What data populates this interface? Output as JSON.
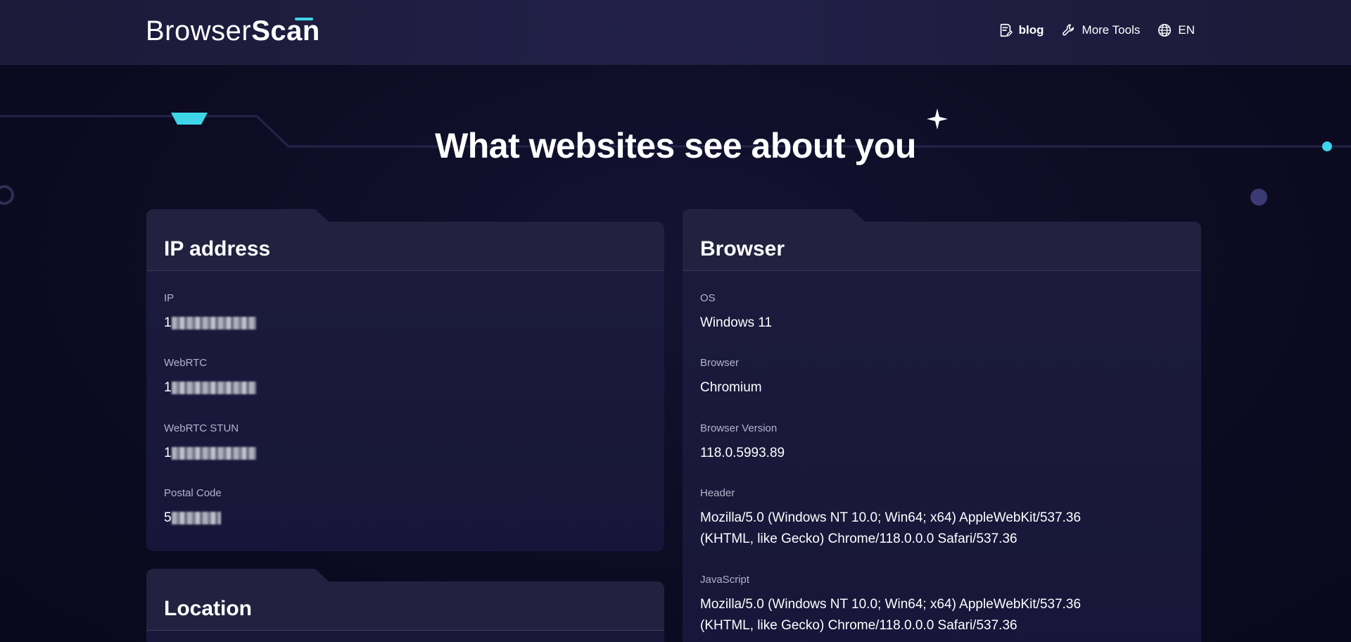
{
  "header": {
    "logo_part1": "Browser",
    "logo_part2": "Scan",
    "nav": [
      {
        "label": "blog",
        "icon": "document-edit-icon"
      },
      {
        "label": "More Tools",
        "icon": "wrench-icon"
      },
      {
        "label": "EN",
        "icon": "globe-icon"
      }
    ]
  },
  "hero": {
    "title": "What websites see about you"
  },
  "ip_card": {
    "title": "IP address",
    "fields": [
      {
        "label": "IP",
        "value": "1"
      },
      {
        "label": "WebRTC",
        "value": "1"
      },
      {
        "label": "WebRTC STUN",
        "value": "1"
      },
      {
        "label": "Postal Code",
        "value": "5"
      }
    ]
  },
  "location_card": {
    "title": "Location"
  },
  "browser_card": {
    "title": "Browser",
    "fields": [
      {
        "label": "OS",
        "value": "Windows 11"
      },
      {
        "label": "Browser",
        "value": "Chromium"
      },
      {
        "label": "Browser Version",
        "value": "118.0.5993.89"
      },
      {
        "label": "Header",
        "value": "Mozilla/5.0 (Windows NT 10.0; Win64; x64) AppleWebKit/537.36 (KHTML, like Gecko) Chrome/118.0.0.0 Safari/537.36"
      },
      {
        "label": "JavaScript",
        "value": "Mozilla/5.0 (Windows NT 10.0; Win64; x64) AppleWebKit/537.36 (KHTML, like Gecko) Chrome/118.0.0.0 Safari/537.36"
      }
    ]
  },
  "colors": {
    "accent": "#3fd5e8",
    "background": "#0d0c24",
    "card": "#1c1b3c"
  }
}
